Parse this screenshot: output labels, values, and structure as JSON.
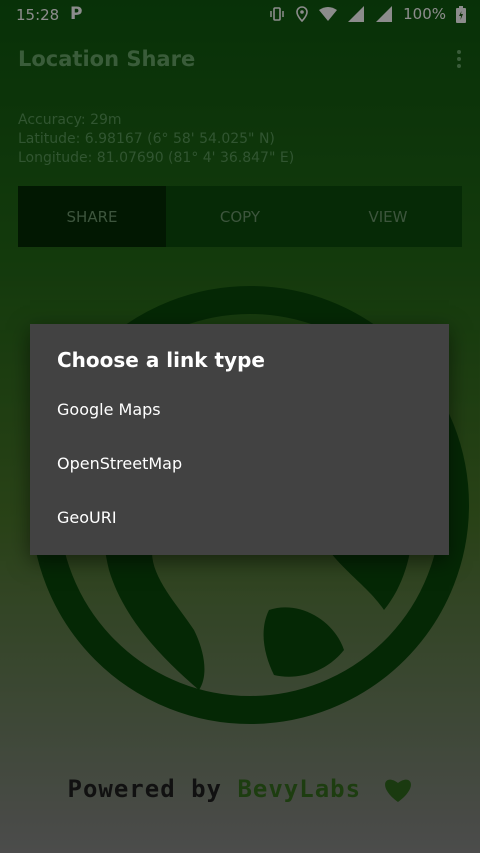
{
  "status_bar": {
    "time": "15:28",
    "notification": "P",
    "battery": "100%"
  },
  "app": {
    "title": "Location Share"
  },
  "location": {
    "accuracy": "Accuracy: 29m",
    "latitude": "Latitude: 6.98167 (6° 58' 54.025\" N)",
    "longitude": "Longitude: 81.07690 (81°  4' 36.847\" E)"
  },
  "actions": {
    "share": "SHARE",
    "copy": "COPY",
    "view": "VIEW"
  },
  "dialog": {
    "title": "Choose a link type",
    "options": [
      "Google Maps",
      "OpenStreetMap",
      "GeoURI"
    ]
  },
  "footer": {
    "powered_by": "Powered by",
    "brand": "BevyLabs"
  },
  "colors": {
    "primary": "#0b4d0b",
    "dialog_bg": "#424242"
  },
  "icons": [
    "vibrate-icon",
    "location-icon",
    "wifi-icon",
    "signal-icon",
    "battery-icon",
    "overflow-menu-icon",
    "globe-logo-icon",
    "heart-icon"
  ]
}
